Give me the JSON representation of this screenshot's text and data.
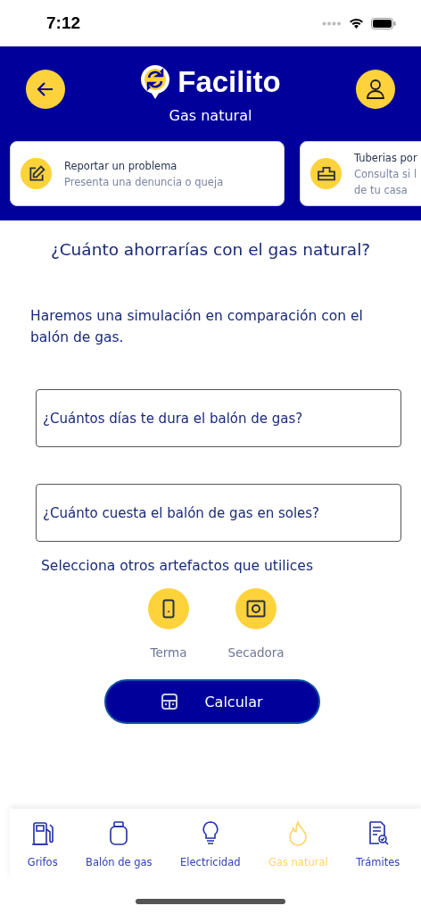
{
  "status_bar": {
    "time": "7:12"
  },
  "header": {
    "app_name": "Facilito",
    "subtitle": "Gas natural"
  },
  "cards": [
    {
      "kind": "report",
      "title": "Reportar un problema",
      "lines": [
        "Presenta una denuncia o queja"
      ]
    },
    {
      "kind": "pipe",
      "title": "Tuberias por",
      "lines": [
        "Consulta si l",
        "de tu casa"
      ]
    }
  ],
  "question": "¿Cuánto ahorrarías con el gas natural?",
  "intro": "Haremos una simulación en comparación con el balón de gas.",
  "fields": [
    {
      "placeholder": "¿Cuántos días te dura el balón de gas?"
    },
    {
      "placeholder": "¿Cuánto cuesta el balón de gas en soles?"
    }
  ],
  "appliances_label": "Selecciona otros artefactos que utilices",
  "appliances": [
    {
      "kind": "heater",
      "label": "Terma"
    },
    {
      "kind": "dryer",
      "label": "Secadora"
    }
  ],
  "calculate_button": "Calcular",
  "tabs": [
    {
      "kind": "pump",
      "label": "Grifos",
      "selected": false
    },
    {
      "kind": "cylinder",
      "label": "Balón de gas",
      "selected": false
    },
    {
      "kind": "bulb",
      "label": "Electricidad",
      "selected": false
    },
    {
      "kind": "flame",
      "label": "Gas natural",
      "selected": true
    },
    {
      "kind": "doc",
      "label": "Trámites",
      "selected": false
    }
  ]
}
